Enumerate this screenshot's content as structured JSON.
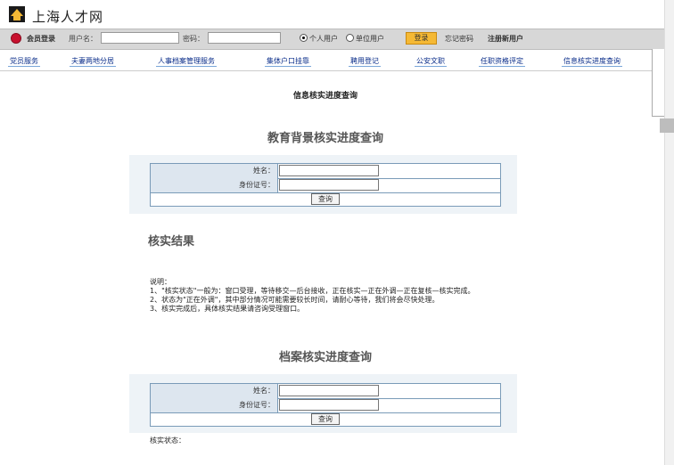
{
  "header": {
    "site_name": "上海人才网"
  },
  "login_bar": {
    "title": "会员登录",
    "username_label": "用户名：",
    "username_value": "",
    "password_label": "密码：",
    "password_value": "",
    "options": [
      "个人用户",
      "单位用户"
    ],
    "selected_option": "个人用户",
    "login_button": "登录",
    "forgot_link": "忘记密码",
    "register_link": "注册新用户"
  },
  "nav": {
    "items": [
      "党员服务",
      "夫妻两地分居",
      "人事档案管理服务",
      "集体户口挂靠",
      "聘用登记",
      "公安文职",
      "任职资格评定",
      "信息核实进度查询"
    ]
  },
  "page": {
    "subtitle": "信息核实进度查询"
  },
  "education": {
    "title": "教育背景核实进度查询",
    "name_label": "姓名：",
    "name_value": "",
    "id_label": "身份证号：",
    "id_value": "",
    "query_button": "查询"
  },
  "result": {
    "title": "核实结果",
    "notes": [
      "说明：",
      "1、\"核实状态\"一般为：窗口受理，等待移交—后台接收，正在核实—正在外调—正在复核—核实完成。",
      "2、状态为\"正在外调\"，其中部分情况可能需要较长时间，请耐心等待，我们将会尽快处理。",
      "3、核实完成后，具体核实结果请咨询受理窗口。"
    ]
  },
  "archive": {
    "title": "档案核实进度查询",
    "name_label": "姓名：",
    "name_value": "",
    "id_label": "身份证号：",
    "id_value": "",
    "query_button": "查询",
    "status_label": "核实状态："
  },
  "colors": {
    "login_bar": "#d7d7d7",
    "login_button": "#f5b935",
    "nav_text": "#0a2d8a",
    "form_border": "#7a9bb8",
    "label_bg": "#dde6ef"
  }
}
